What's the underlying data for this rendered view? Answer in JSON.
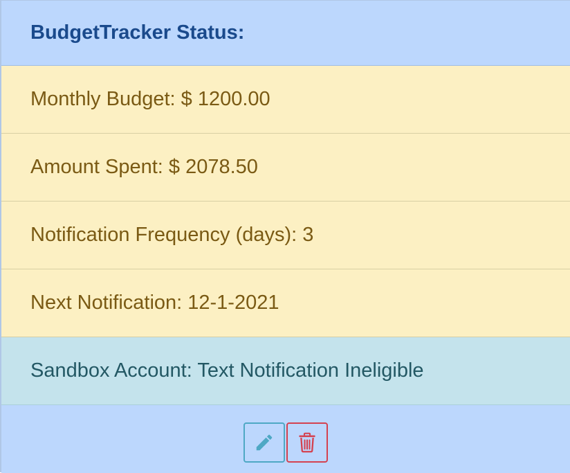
{
  "header": {
    "title": "BudgetTracker Status:"
  },
  "rows": [
    {
      "text": "Monthly Budget: $ 1200.00"
    },
    {
      "text": "Amount Spent: $ 2078.50"
    },
    {
      "text": "Notification Frequency (days): 3"
    },
    {
      "text": "Next Notification: 12-1-2021"
    }
  ],
  "sandbox": {
    "text": "Sandbox Account: Text Notification Ineligible"
  },
  "actions": {
    "edit_icon": "pencil-icon",
    "delete_icon": "trash-icon"
  },
  "colors": {
    "header_bg": "#bcd7fd",
    "warning_bg": "#fcf0c3",
    "info_bg": "#c4e3ec",
    "edit_accent": "#4ea8c4",
    "delete_accent": "#d4414f"
  }
}
